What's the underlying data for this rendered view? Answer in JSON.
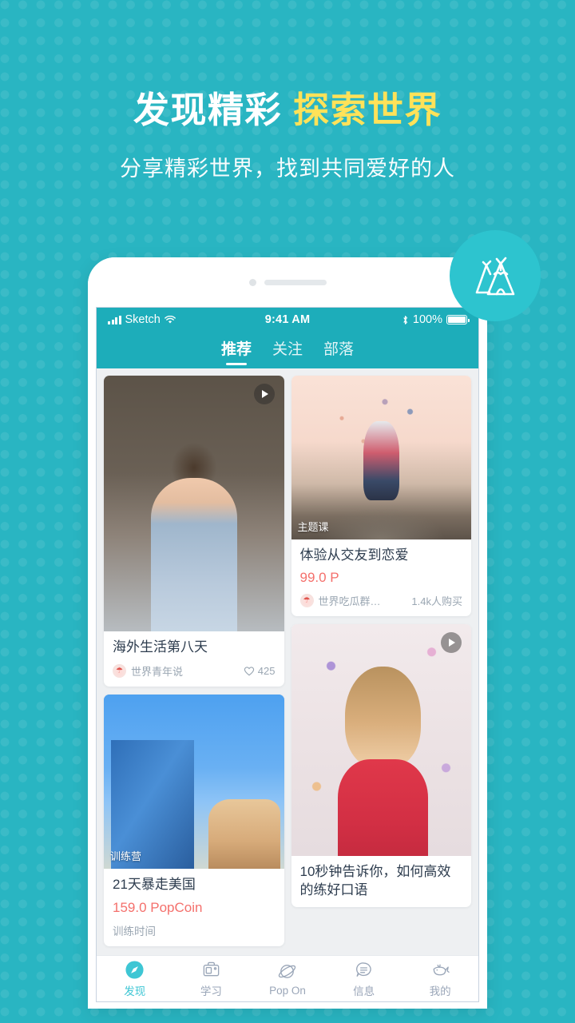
{
  "hero": {
    "title_white": "发现精彩",
    "title_accent": "探索世界",
    "subtitle": "分享精彩世界，找到共同爱好的人",
    "accent_color": "#ffe259",
    "background_color": "#29b5c2"
  },
  "badge": {
    "icon": "teepee-tent-icon",
    "color": "#2dc4cf"
  },
  "status_bar": {
    "carrier": "Sketch",
    "time": "9:41 AM",
    "battery": "100%",
    "signal_icon": "signal-bars-icon",
    "wifi_icon": "wifi-icon",
    "bluetooth_icon": "bluetooth-icon",
    "battery_icon": "battery-full-icon"
  },
  "tabs": [
    {
      "label": "推荐",
      "active": true
    },
    {
      "label": "关注",
      "active": false
    },
    {
      "label": "部落",
      "active": false
    }
  ],
  "feed": {
    "left_column": [
      {
        "id": "card-overseas-life",
        "image": "man-in-office-photo",
        "has_play": true,
        "play_icon": "play-icon",
        "badge": "",
        "title": "海外生活第八天",
        "price": "",
        "author": "世界青年说",
        "avatar_icon": "user-avatar-icon",
        "right_meta": "425",
        "right_icon": "heart-icon",
        "sub_label": ""
      },
      {
        "id": "card-21-days-usa",
        "image": "city-skyline-photo",
        "has_play": false,
        "play_icon": "",
        "badge": "训练营",
        "title": "21天暴走美国",
        "price": "159.0 PopCoin",
        "author": "",
        "avatar_icon": "",
        "right_meta": "",
        "right_icon": "",
        "sub_label": "训练时间"
      }
    ],
    "right_column": [
      {
        "id": "card-dating-course",
        "image": "couple-hot-air-balloons-photo",
        "has_play": false,
        "play_icon": "",
        "badge": "主题课",
        "title": "体验从交友到恋爱",
        "price": "99.0 P",
        "author": "世界吃瓜群…",
        "avatar_icon": "user-avatar-icon",
        "right_meta": "1.4k人购买",
        "right_icon": "",
        "sub_label": ""
      },
      {
        "id": "card-spoken-english",
        "image": "girl-with-confetti-photo",
        "has_play": true,
        "play_icon": "play-icon",
        "badge": "",
        "title": "10秒钟告诉你，如何高效的练好口语",
        "price": "",
        "author": "",
        "avatar_icon": "",
        "right_meta": "",
        "right_icon": "",
        "sub_label": ""
      }
    ]
  },
  "bottom_nav": [
    {
      "label": "发现",
      "icon": "compass-icon",
      "active": true
    },
    {
      "label": "学习",
      "icon": "briefcase-icon",
      "active": false
    },
    {
      "label": "Pop On",
      "icon": "planet-icon",
      "active": false
    },
    {
      "label": "信息",
      "icon": "speech-bubble-icon",
      "active": false
    },
    {
      "label": "我的",
      "icon": "whale-icon",
      "active": false
    }
  ],
  "colors": {
    "teal": "#29b5c2",
    "header_teal": "#1dadba",
    "accent_yellow": "#ffe259",
    "price_red": "#f4706c",
    "nav_active": "#3ec6d4",
    "screen_bg": "#eef0f2"
  }
}
